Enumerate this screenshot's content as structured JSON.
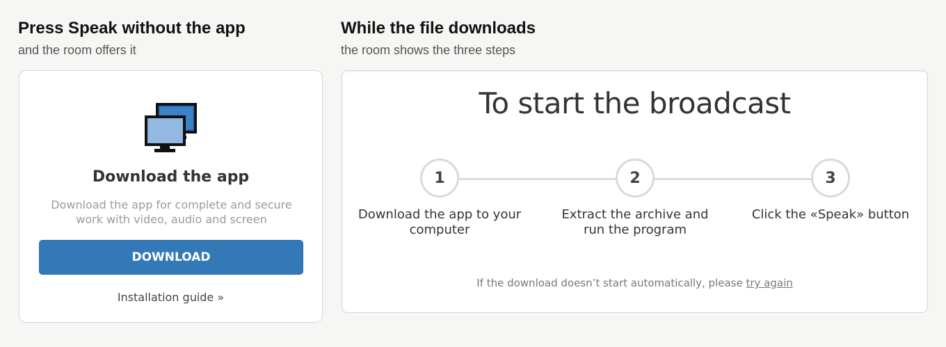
{
  "left_panel": {
    "title": "Press Speak without the app",
    "subtitle": "and the room offers it",
    "card": {
      "icon": "monitors-icon",
      "heading": "Download the app",
      "description": "Download the app for complete and secure work with video, audio and screen",
      "download_label": "DOWNLOAD",
      "guide_label": "Installation guide »"
    }
  },
  "right_panel": {
    "title": "While the file downloads",
    "subtitle": "the room shows the three steps",
    "card": {
      "heading": "To start the broadcast",
      "steps": [
        {
          "number": "1",
          "text": "Download the app to your computer"
        },
        {
          "number": "2",
          "text": "Extract the archive and run the program"
        },
        {
          "number": "3",
          "text": "Click the «Speak» button"
        }
      ],
      "retry_prefix": "If the download doesn’t start automatically, please ",
      "retry_link": "try again"
    }
  },
  "colors": {
    "accent": "#3378b7",
    "background": "#f6f6f4",
    "card": "#ffffff"
  }
}
